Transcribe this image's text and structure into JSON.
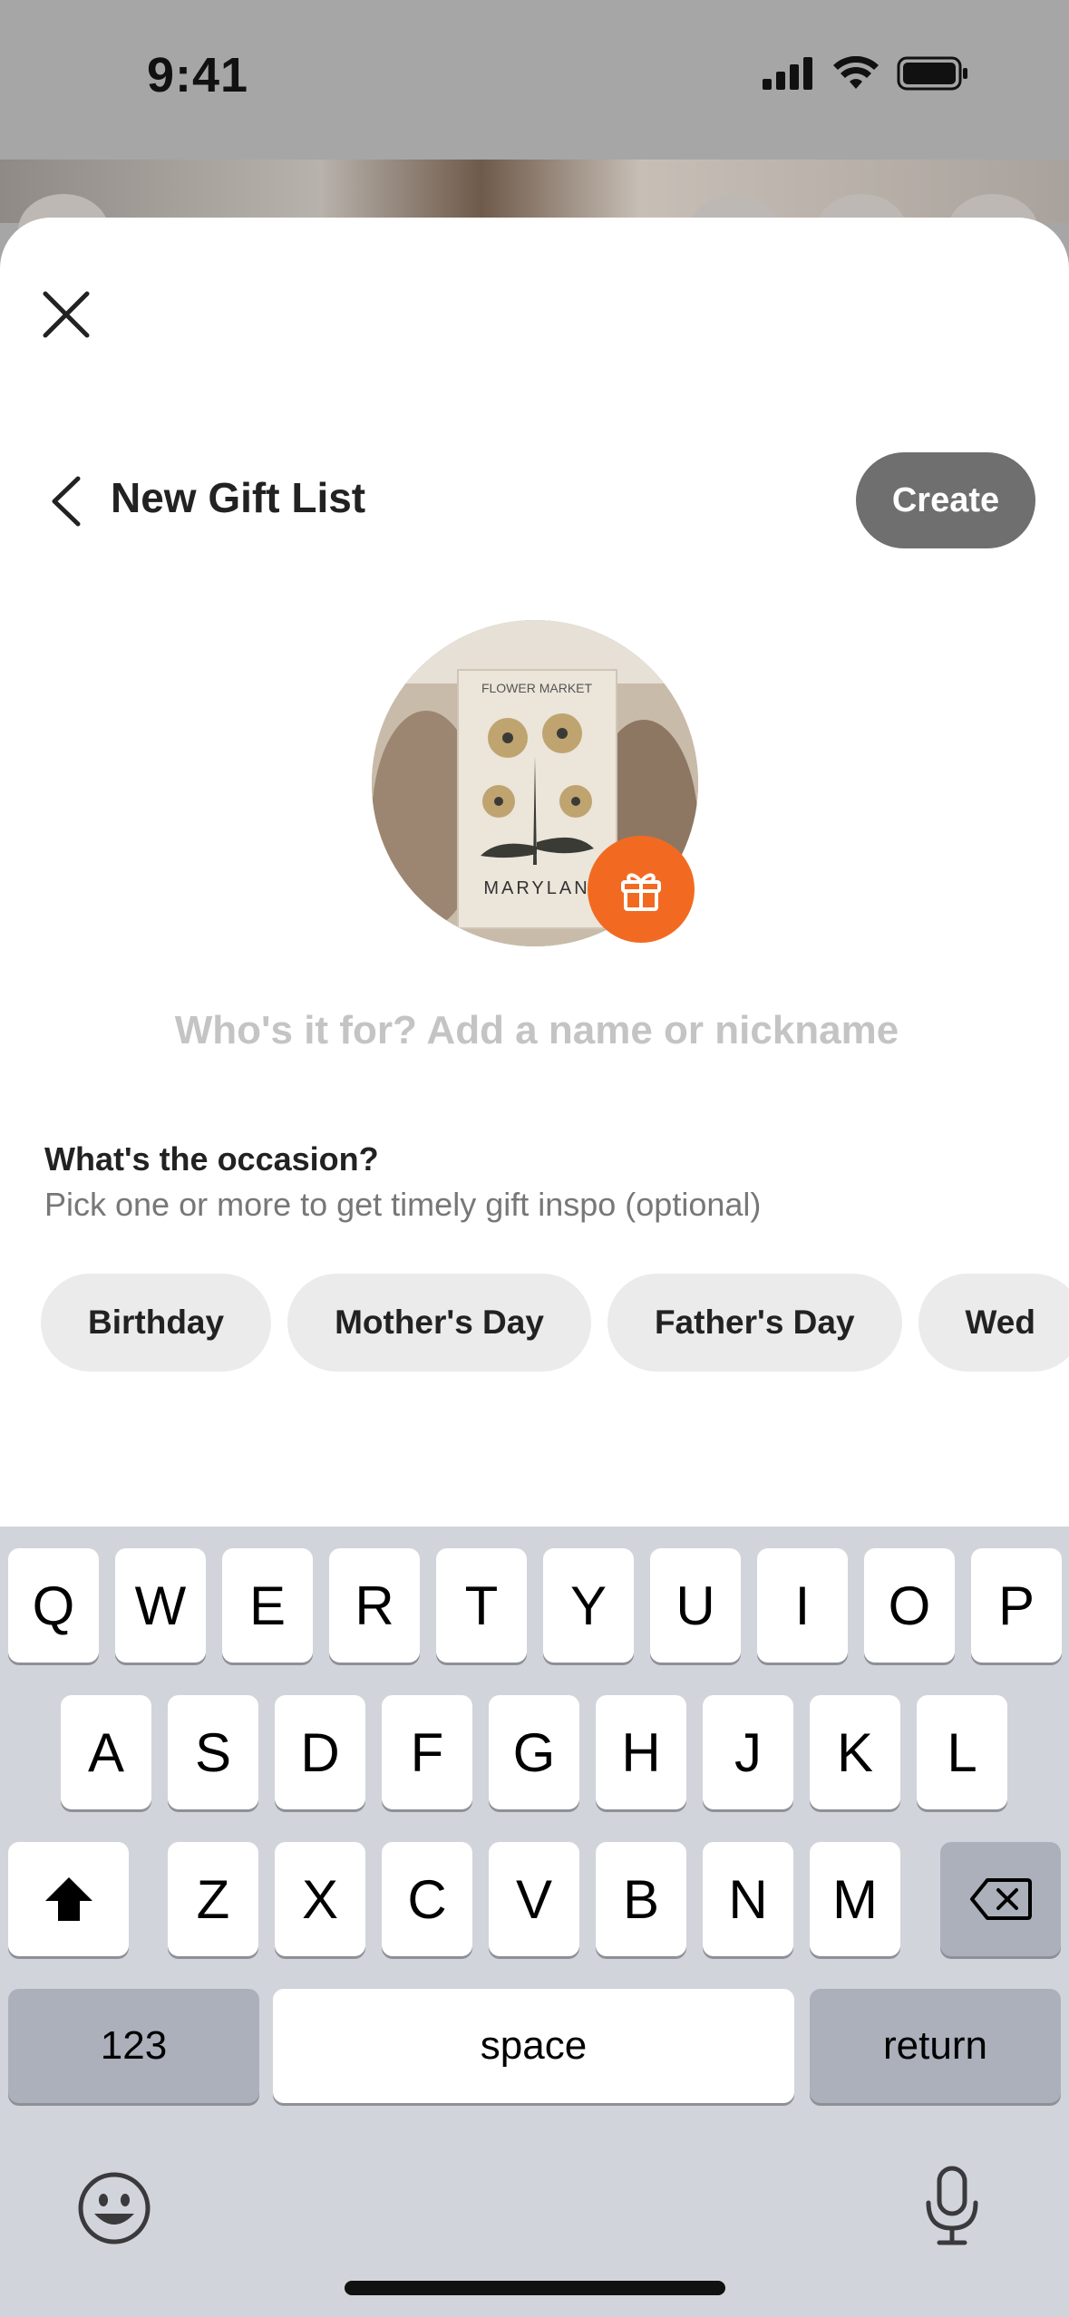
{
  "status_bar": {
    "time": "9:41"
  },
  "nav": {
    "title": "New Gift List",
    "create_label": "Create"
  },
  "avatar": {
    "poster_title": "FLOWER MARKET",
    "poster_caption": "MARYLAN"
  },
  "name_field": {
    "placeholder": "Who's it for? Add a name or nickname",
    "value": ""
  },
  "occasion": {
    "title": "What's the occasion?",
    "subtitle": "Pick one or more to get timely gift inspo (optional)",
    "chips": [
      "Birthday",
      "Mother's Day",
      "Father's Day",
      "Wed"
    ]
  },
  "keyboard": {
    "row1": [
      "Q",
      "W",
      "E",
      "R",
      "T",
      "Y",
      "U",
      "I",
      "O",
      "P"
    ],
    "row2": [
      "A",
      "S",
      "D",
      "F",
      "G",
      "H",
      "J",
      "K",
      "L"
    ],
    "row3": [
      "Z",
      "X",
      "C",
      "V",
      "B",
      "N",
      "M"
    ],
    "numbers_label": "123",
    "space_label": "space",
    "return_label": "return"
  },
  "colors": {
    "accent": "#f26a21",
    "create_button": "#6f6f6f",
    "chip_bg": "#ebebeb"
  }
}
